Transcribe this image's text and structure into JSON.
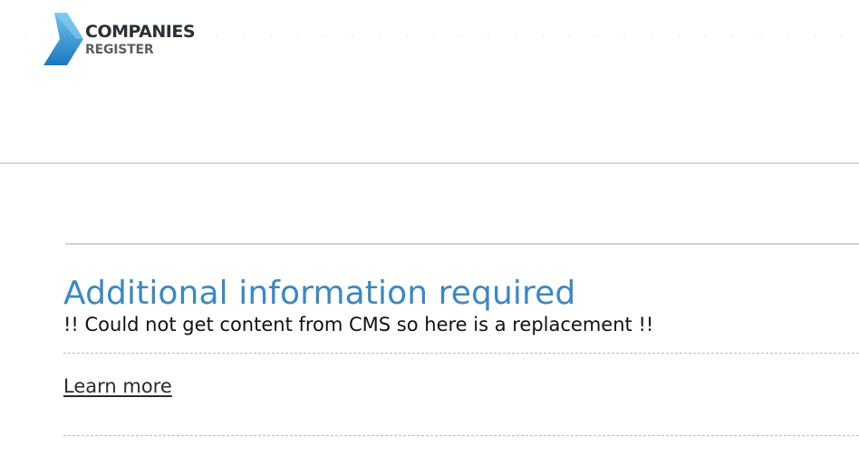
{
  "header": {
    "logo": {
      "line1": "COMPANIES",
      "line2": "REGISTER",
      "icon": "chevron-logo-icon",
      "colors": {
        "mark_light": "#5ab8e6",
        "mark_dark": "#1f7fc0",
        "text": "#2b3036"
      }
    }
  },
  "main": {
    "title": "Additional information required",
    "message": "!! Could not get content from CMS so here is a replacement !!",
    "link_label": "Learn more"
  },
  "colors": {
    "accent": "#3b88c3",
    "divider": "#cfcfcf"
  }
}
